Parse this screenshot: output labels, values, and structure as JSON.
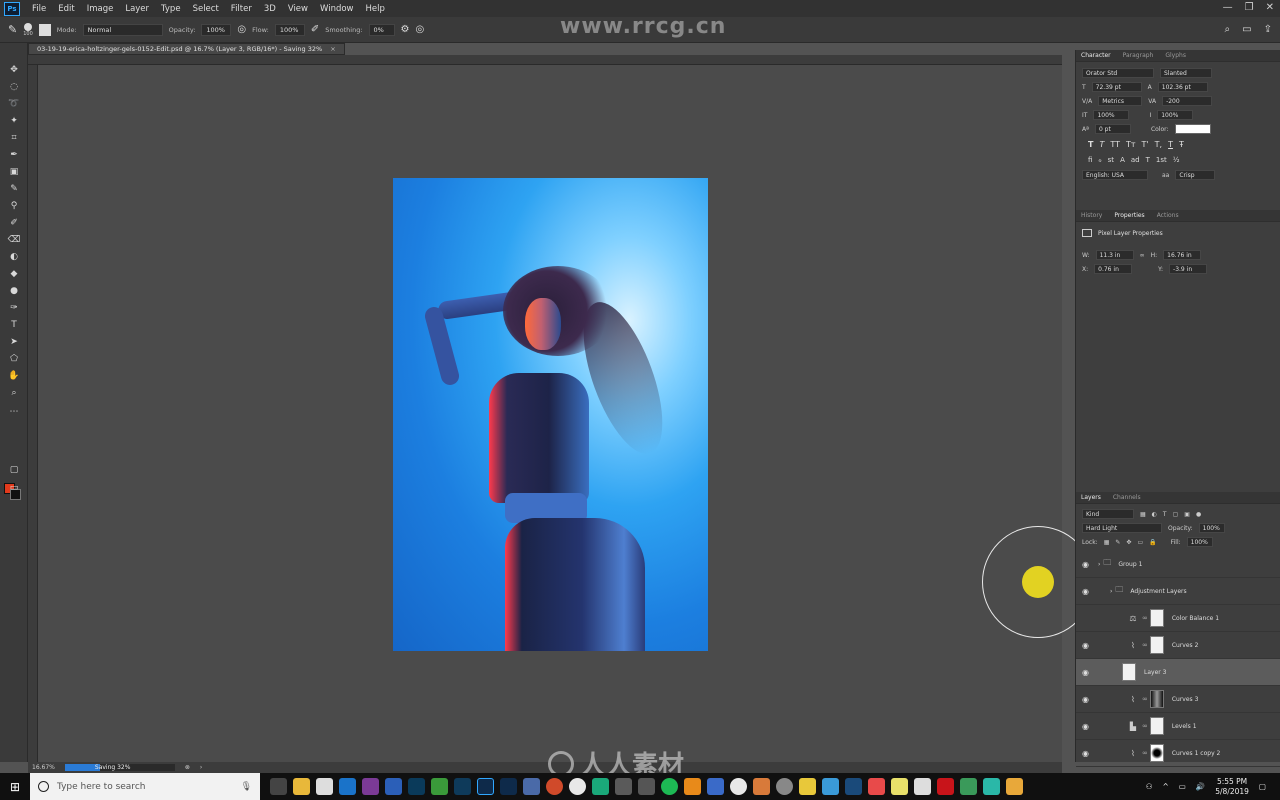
{
  "app": {
    "logo": "Ps"
  },
  "menu": [
    "File",
    "Edit",
    "Image",
    "Layer",
    "Type",
    "Select",
    "Filter",
    "3D",
    "View",
    "Window",
    "Help"
  ],
  "options_bar": {
    "brush_size": "100",
    "mode_label": "Mode:",
    "mode_value": "Normal",
    "opacity_label": "Opacity:",
    "opacity_value": "100%",
    "flow_label": "Flow:",
    "flow_value": "100%",
    "smoothing_label": "Smoothing:",
    "smoothing_value": "0%"
  },
  "document": {
    "tab_title": "03-19-19-erica-holtzinger-gels-0152-Edit.psd @ 16.7% (Layer 3, RGB/16*) - Saving 32%",
    "close_glyph": "×"
  },
  "watermark": {
    "url": "www.rrcg.cn",
    "bottom_text": "人人素材"
  },
  "status": {
    "zoom": "16.67%",
    "progress_label": "Saving 32%",
    "progress_fraction": 0.32
  },
  "character_panel": {
    "tabs": [
      "Character",
      "Paragraph",
      "Glyphs"
    ],
    "font_family": "Orator Std",
    "font_style": "Slanted",
    "font_size": "72.39 pt",
    "leading": "102.36 pt",
    "kerning": "Metrics",
    "tracking": "-200",
    "vertical_scale": "100%",
    "horizontal_scale": "100%",
    "baseline_shift": "0 pt",
    "color_label": "Color:",
    "color_value": "#ffffff",
    "type_style_glyphs": [
      "T",
      "T",
      "TT",
      "Tт",
      "T'",
      "T,",
      "T",
      "Ŧ"
    ],
    "opentype_glyphs": [
      "fi",
      "ℴ",
      "st",
      "A",
      "ad",
      "T",
      "1st",
      "½"
    ],
    "language": "English: USA",
    "antialias": "Crisp"
  },
  "properties_panel": {
    "tabs": [
      "History",
      "Properties",
      "Actions"
    ],
    "title": "Pixel Layer Properties",
    "w_label": "W:",
    "w_value": "11.3 in",
    "h_label": "H:",
    "h_value": "16.76 in",
    "x_label": "X:",
    "x_value": "0.76 in",
    "y_label": "Y:",
    "y_value": "-3.9 in"
  },
  "layers_panel": {
    "tabs": [
      "Layers",
      "Channels"
    ],
    "filter_kind": "Kind",
    "blend_mode": "Hard Light",
    "opacity_label": "Opacity:",
    "opacity_value": "100%",
    "lock_label": "Lock:",
    "fill_label": "Fill:",
    "fill_value": "100%",
    "layers": [
      {
        "name": "Group 1",
        "type": "group"
      },
      {
        "name": "Adjustment Layers",
        "type": "group"
      },
      {
        "name": "Color Balance 1",
        "type": "adjustment"
      },
      {
        "name": "Curves 2",
        "type": "adjustment"
      },
      {
        "name": "Layer 3",
        "type": "pixel"
      },
      {
        "name": "Curves 3",
        "type": "adjustment"
      },
      {
        "name": "Levels 1",
        "type": "adjustment"
      },
      {
        "name": "Curves 1 copy 2",
        "type": "adjustment"
      }
    ]
  },
  "taskbar": {
    "search_placeholder": "Type here to search",
    "time": "5:55 PM",
    "date": "5/8/2019"
  }
}
